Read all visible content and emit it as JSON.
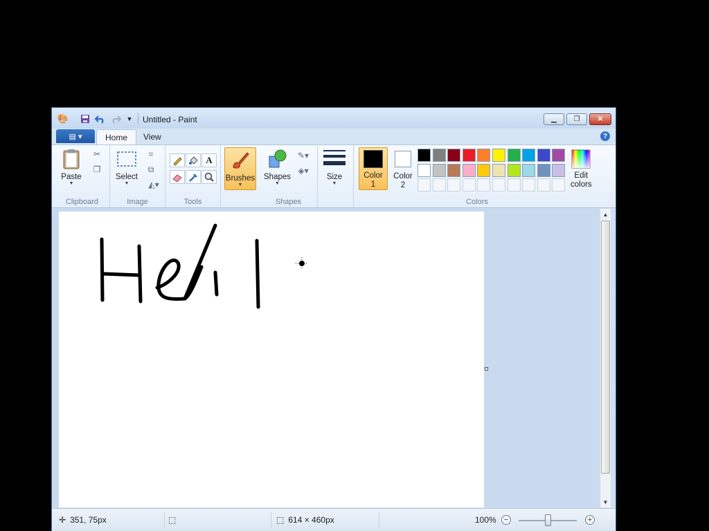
{
  "window": {
    "title": "Untitled - Paint"
  },
  "tabs": {
    "home": "Home",
    "view": "View"
  },
  "ribbon": {
    "clipboard": {
      "label": "Clipboard",
      "paste": "Paste"
    },
    "image": {
      "label": "Image",
      "select": "Select"
    },
    "tools": {
      "label": "Tools"
    },
    "brushes": "Brushes",
    "shapes": {
      "label": "Shapes",
      "button": "Shapes"
    },
    "size": "Size",
    "colors": {
      "label": "Colors",
      "color1_line1": "Color",
      "color1_line2": "1",
      "color2_line1": "Color",
      "color2_line2": "2",
      "edit_line1": "Edit",
      "edit_line2": "colors",
      "color1_value": "#000000",
      "color2_value": "#ffffff",
      "palette_row1": [
        "#000000",
        "#7f7f7f",
        "#880015",
        "#ed1c24",
        "#ff7f27",
        "#fff200",
        "#22b14c",
        "#00a2e8",
        "#3f48cc",
        "#a349a4"
      ],
      "palette_row2": [
        "#ffffff",
        "#c3c3c3",
        "#b97a57",
        "#ffaec9",
        "#ffc90e",
        "#efe4b0",
        "#b5e61d",
        "#99d9ea",
        "#7092be",
        "#c8bfe7"
      ]
    }
  },
  "icons": {
    "quick_access": [
      "paint-app-icon",
      "save-icon",
      "undo-icon",
      "redo-icon",
      "customize-qat-icon"
    ],
    "window_controls": [
      "minimize-icon",
      "restore-icon",
      "close-icon"
    ]
  },
  "status": {
    "cursor_position": "351, 75px",
    "image_size": "614 × 460px",
    "zoom": "100%",
    "zoom_level_percent": 100
  }
}
